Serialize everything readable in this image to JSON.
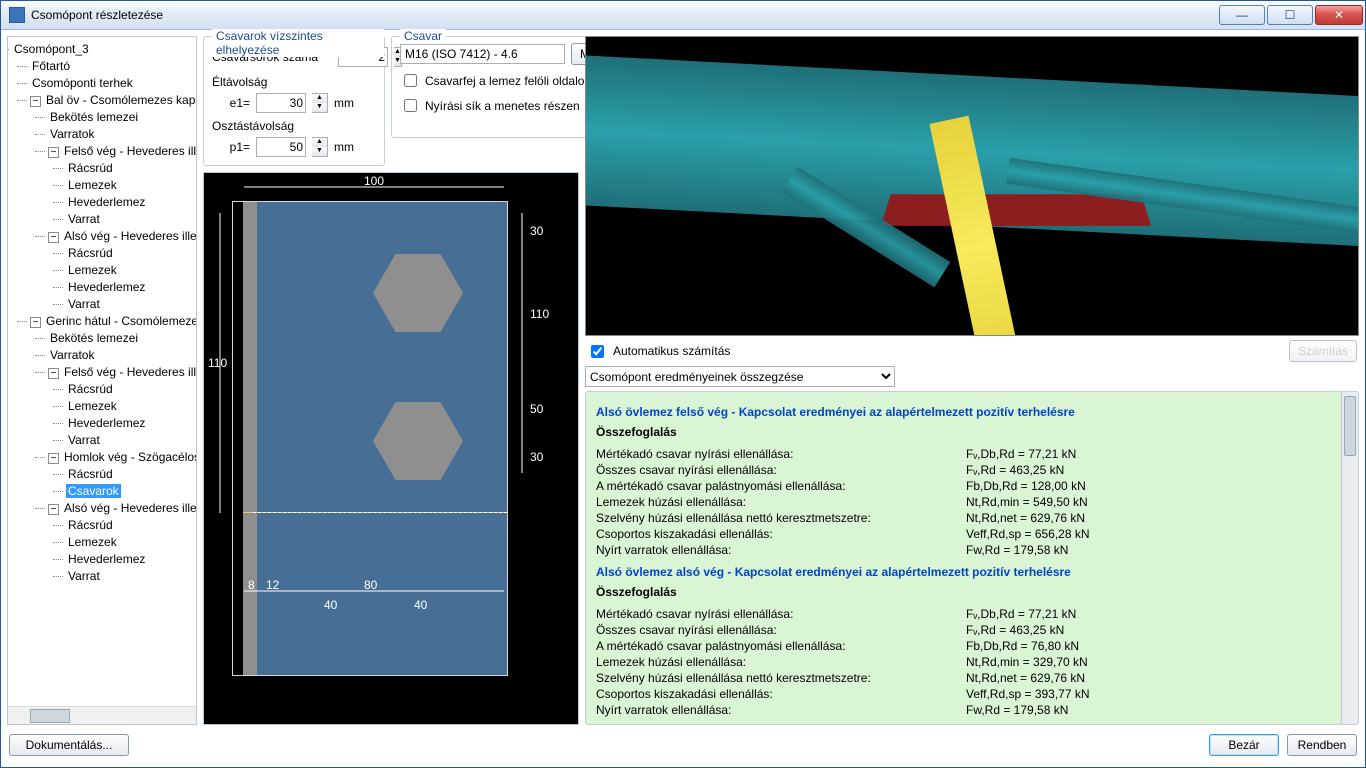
{
  "window": {
    "title": "Csomópont részletezése"
  },
  "tree": {
    "root": "Csomópont_3",
    "n1": "Főtartó",
    "n2": "Csomóponti terhek",
    "n3": "Bal öv - Csomólemezes kapc",
    "n3a": "Bekötés lemezei",
    "n3b": "Varratok",
    "n3c": "Felső vég - Hevederes ill",
    "n3ca": "Rácsrúd",
    "n3cb": "Lemezek",
    "n3cc": "Hevederlemez",
    "n3cd": "Varrat",
    "n3d": "Alsó vég - Hevederes ille",
    "n4": "Gerinc hátul - Csomólemezes",
    "n4a": "Bekötés lemezei",
    "n4b": "Varratok",
    "n4c": "Felső vég - Hevederes ill",
    "n5": "Homlok vég - Szögacélos",
    "n5a": "Rácsrúd",
    "n5b": "Csavarok",
    "n6": "Alsó vég - Hevederes ille",
    "n6a": "Rácsrúd",
    "n6b": "Lemezek",
    "n6c": "Hevederlemez",
    "n6d": "Varrat"
  },
  "groups": {
    "horiz_title": "Csavarok vízszintes elhelyezése",
    "rows_label": "Csavarsorok száma",
    "rows_value": "2",
    "edge_title": "Éltávolság",
    "e1_label": "e1=",
    "e1_value": "30",
    "pitch_title": "Osztástávolság",
    "p1_label": "p1=",
    "p1_value": "50",
    "unit": "mm",
    "bolt_title": "Csavar",
    "bolt_value": "M16 (ISO 7412) - 4.6",
    "modify": "Módosít...",
    "chk1": "Csavarfej a lemez felöli oldalon",
    "chk2": "Nyírási sík a menetes részen"
  },
  "dims": {
    "top": "100",
    "r1": "30",
    "r2": "110",
    "r3": "50",
    "r4": "30",
    "leftv": "110",
    "b1": "8",
    "b2": "12",
    "b3": "80",
    "b4": "40",
    "b5": "40"
  },
  "calc": {
    "auto": "Automatikus számítás",
    "btn": "Számítás",
    "combo": "Csomópont eredményeinek összegzése"
  },
  "results": {
    "h1": "Alsó övlemez felső vég - Kapcsolat eredményei az alapértelmezett pozitív terhelésre",
    "h2": "Alsó övlemez alsó vég - Kapcsolat eredményei az alapértelmezett pozitív terhelésre",
    "summary": "Összefoglalás",
    "k1": "Mértékadó csavar nyírási ellenállása:",
    "k2": "Összes csavar nyírási ellenállása:",
    "k3": "A mértékadó csavar palástnyomási ellenállása:",
    "k4": "Lemezek húzási ellenállása:",
    "k5": "Szelvény húzási ellenállása nettó keresztmetszetre:",
    "k6": "Csoportos kiszakadási ellenállás:",
    "k7": "Nyírt varratok ellenállása:",
    "v1a": "Fᵥ,Db,Rd = 77,21 kN",
    "v2a": "Fᵥ,Rd = 463,25 kN",
    "v3a": "Fb,Db,Rd = 128,00 kN",
    "v4a": "Nt,Rd,min = 549,50 kN",
    "v5a": "Nt,Rd,net = 629,76 kN",
    "v6a": "Veff,Rd,sp = 656,28 kN",
    "v7a": "Fw,Rd = 179,58 kN",
    "v3b": "Fb,Db,Rd = 76,80 kN",
    "v4b": "Nt,Rd,min = 329,70 kN",
    "v6b": "Veff,Rd,sp = 393,77 kN"
  },
  "footer": {
    "doc": "Dokumentálás...",
    "close": "Bezár",
    "ok": "Rendben"
  }
}
